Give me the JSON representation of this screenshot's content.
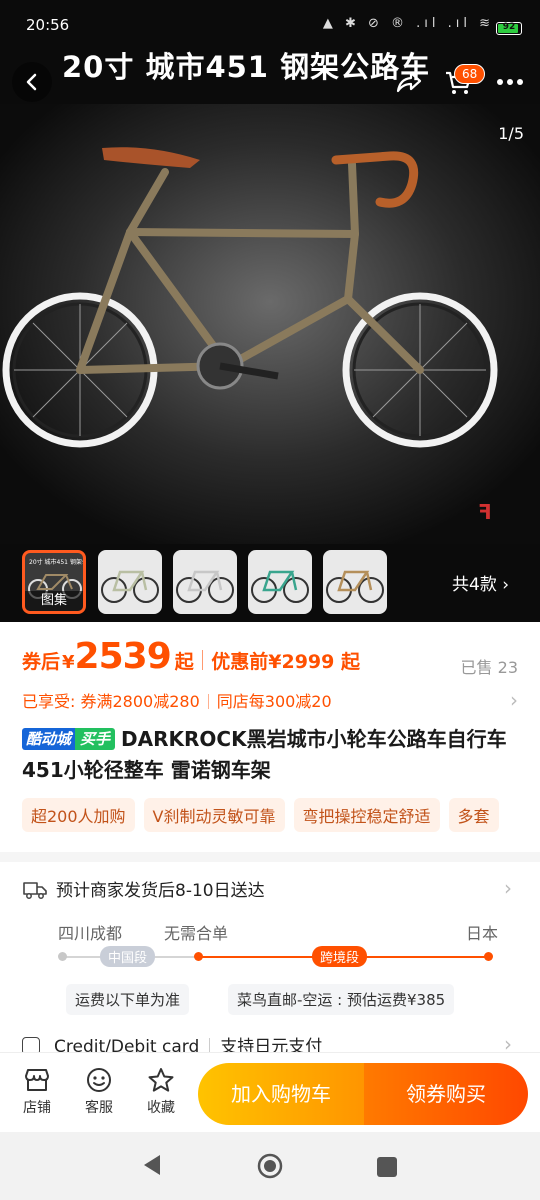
{
  "status_bar": {
    "time": "20:56",
    "icons": "▲ ✱ ⊘ ® .ıl .ıl ≋",
    "battery": "92"
  },
  "hero": {
    "title": "20寸 城市451 钢架公路车",
    "cart_count": "68",
    "image_counter": "1/5",
    "thumb_caption": "20寸 城市451 钢架公路车",
    "thumb_label": "图集",
    "variants_label": "共4款",
    "icons": {
      "back": "back-arrow-icon",
      "share": "share-icon",
      "cart": "cart-icon",
      "more": "more-icon"
    }
  },
  "price": {
    "after_coupon_label": "券后",
    "currency": "¥",
    "value": "2539",
    "suffix": "起",
    "before_discount": "优惠前¥2999 起",
    "sold": "已售 23",
    "promo_prefix": "已享受:",
    "promo_1": "券满2800减280",
    "promo_2": "同店每300减20"
  },
  "product": {
    "badge_1": "酷动城",
    "badge_2": "买手",
    "title": "DARKROCK黑岩城市小轮车公路车自行车 451小轮径整车 雷诺钢车架",
    "chips": [
      "超200人加购",
      "V刹制动灵敏可靠",
      "弯把操控稳定舒适",
      "多套"
    ]
  },
  "shipping": {
    "headline": "预计商家发货后8-10日送达",
    "origin": "四川成都",
    "merge": "无需合单",
    "destination": "日本",
    "segment_domestic": "中国段",
    "segment_cross": "跨境段",
    "note_domestic": "运费以下单为准",
    "note_cross": "菜鸟直邮-空运 : 预估运费¥385"
  },
  "payment": {
    "method": "Credit/Debit card",
    "support": "支持日元支付"
  },
  "action_bar": {
    "store": "店铺",
    "service": "客服",
    "favorite": "收藏",
    "add_to_cart": "加入购物车",
    "buy": "领券购买"
  },
  "colors": {
    "accent": "#ff5000",
    "cart_button": "#ffb300",
    "buy_button": "#ff5a00"
  }
}
